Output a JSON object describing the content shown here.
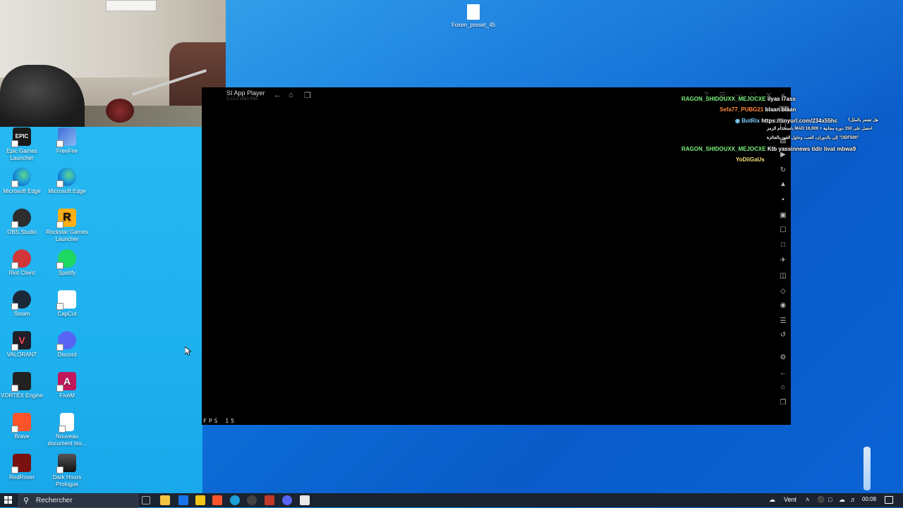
{
  "webcam": {
    "label": "webcam-feed"
  },
  "top_file": {
    "label": "Foxen_preset_45"
  },
  "desktop_icons": [
    {
      "label": "Epic Games Launcher",
      "glyph": "EPIC"
    },
    {
      "label": "FreeFire",
      "glyph": ""
    },
    {
      "label": "Microsoft Edge",
      "glyph": ""
    },
    {
      "label": "Microsoft Edge",
      "glyph": ""
    },
    {
      "label": "OBS Studio",
      "glyph": ""
    },
    {
      "label": "Rockstar Games Launcher",
      "glyph": "R"
    },
    {
      "label": "Riot Client",
      "glyph": ""
    },
    {
      "label": "Spotify",
      "glyph": ""
    },
    {
      "label": "Steam",
      "glyph": ""
    },
    {
      "label": "CapCut",
      "glyph": ""
    },
    {
      "label": "VALORANT",
      "glyph": "V"
    },
    {
      "label": "Discord",
      "glyph": ""
    },
    {
      "label": "VORTEX Engine",
      "glyph": ""
    },
    {
      "label": "FiveM",
      "glyph": "A"
    },
    {
      "label": "Brave",
      "glyph": ""
    },
    {
      "label": "Nouveau document tex...",
      "glyph": ""
    },
    {
      "label": "RedRover",
      "glyph": ""
    },
    {
      "label": "Dark Hours Prologue",
      "glyph": ""
    }
  ],
  "player": {
    "title": "SI App Player",
    "subtitle": "5.12.0.1083 P64",
    "fps_label": "FPS",
    "fps_value": "15"
  },
  "chat": [
    {
      "user": "RAGON_SHIDOUXX_MEJOCXE",
      "message": "ilyas l7ass",
      "user_color": "#7cf07c"
    },
    {
      "user": "Sefa77_PUBG21",
      "message": "blaan blaan",
      "user_color": "#ff8a3d"
    },
    {
      "user": "BotRix",
      "message": "https://tinyurl.com/234x55hc",
      "user_color": "#7fd0ff"
    },
    {
      "user": "",
      "message": "هل تشعر بالملل؟",
      "user_color": "#ffffff"
    },
    {
      "user": "",
      "message": "باستخدام الرمز MAD احصل على 150 دورة مجانية + 16,000",
      "user_color": "#ffffff"
    },
    {
      "user": "",
      "message": "إلى بالدوران، العب، وحاول الفوز بالجائزة \"ODF500\"",
      "user_color": "#ffffff"
    },
    {
      "user": "RAGON_SHIDOUXX_MEJOCXE",
      "message": "Ktb yassinnews tidir livat mbwa9",
      "user_color": "#7cf07c"
    },
    {
      "user": "YoDiiGaUs",
      "message": "",
      "user_color": "#f5e27a"
    }
  ],
  "taskbar": {
    "search_placeholder": "Rechercher",
    "weather": "Vent",
    "time": "00:08"
  },
  "colors": {
    "desktop_bg": "#0c6fd8",
    "taskbar_bg": "#1b2330",
    "player_bg": "#000000"
  }
}
